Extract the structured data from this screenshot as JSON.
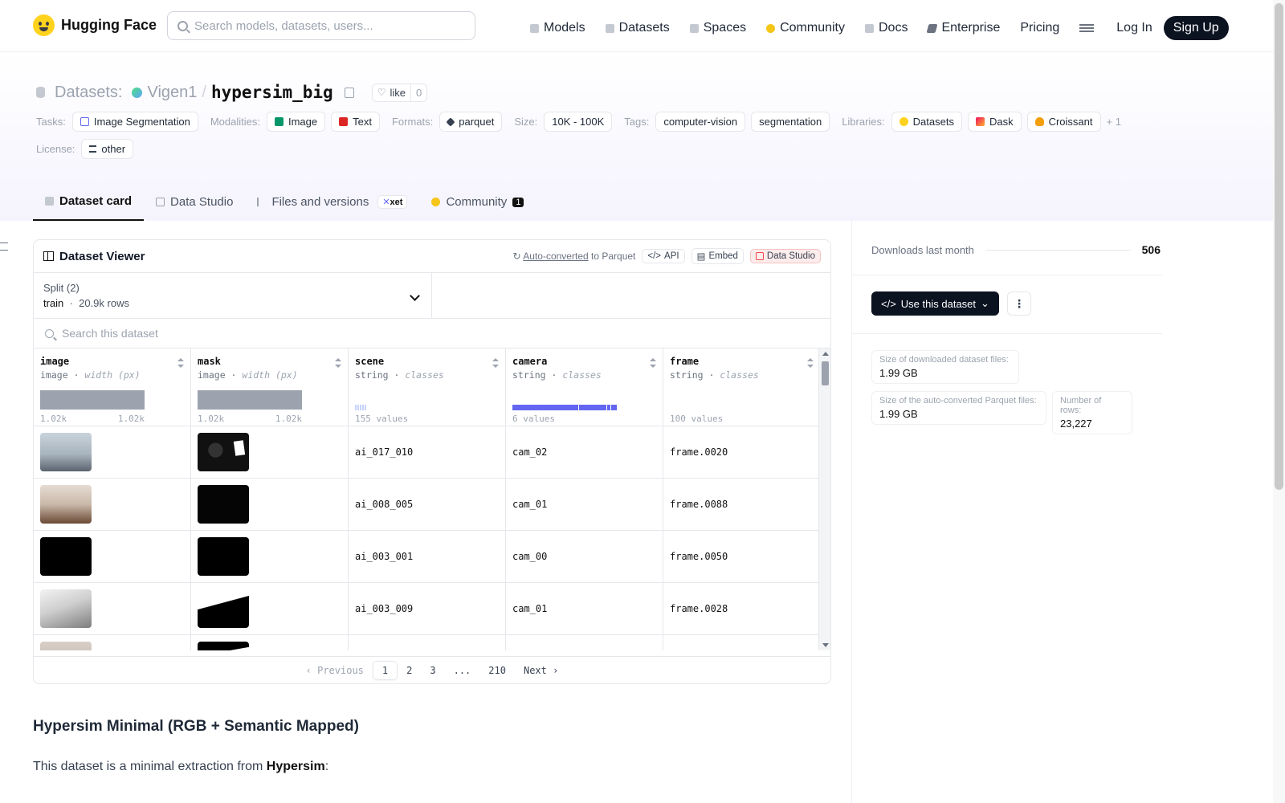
{
  "nav": {
    "brand": "Hugging Face",
    "search_placeholder": "Search models, datasets, users...",
    "links": [
      "Models",
      "Datasets",
      "Spaces",
      "Community",
      "Docs",
      "Enterprise",
      "Pricing"
    ],
    "login": "Log In",
    "signup": "Sign Up"
  },
  "header": {
    "crumb_label": "Datasets:",
    "owner": "Vigen1",
    "slash": "/",
    "name": "hypersim_big",
    "like_label": "like",
    "like_count": "0",
    "tags": {
      "tasks_label": "Tasks:",
      "tasks": [
        "Image Segmentation"
      ],
      "modalities_label": "Modalities:",
      "modalities": [
        "Image",
        "Text"
      ],
      "formats_label": "Formats:",
      "formats": [
        "parquet"
      ],
      "size_label": "Size:",
      "size": "10K - 100K",
      "tags_label": "Tags:",
      "tags": [
        "computer-vision",
        "segmentation"
      ],
      "libraries_label": "Libraries:",
      "libraries": [
        "Datasets",
        "Dask",
        "Croissant"
      ],
      "more": "+ 1",
      "license_label": "License:",
      "license": "other"
    },
    "tabs": [
      "Dataset card",
      "Data Studio",
      "Files and versions",
      "Community"
    ],
    "xet_badge": "xet",
    "community_count": "1"
  },
  "viewer": {
    "title": "Dataset Viewer",
    "autoconv_link": "Auto-converted",
    "autoconv_rest": "to Parquet",
    "api": "API",
    "embed": "Embed",
    "studio": "Data Studio",
    "split_label": "Split (2)",
    "split_value": "train",
    "split_dot": "·",
    "split_rows": "20.9k rows",
    "search_placeholder": "Search this dataset",
    "columns": [
      {
        "name": "image",
        "type": "image",
        "stat": "width (px)",
        "min": "1.02k",
        "max": "1.02k"
      },
      {
        "name": "mask",
        "type": "image",
        "stat": "width (px)",
        "min": "1.02k",
        "max": "1.02k"
      },
      {
        "name": "scene",
        "type": "string",
        "stat": "classes",
        "values": "155 values"
      },
      {
        "name": "camera",
        "type": "string",
        "stat": "classes",
        "values": "6 values"
      },
      {
        "name": "frame",
        "type": "string",
        "stat": "classes",
        "values": "100 values"
      }
    ],
    "rows": [
      {
        "scene": "ai_017_010",
        "camera": "cam_02",
        "frame": "frame.0020"
      },
      {
        "scene": "ai_008_005",
        "camera": "cam_01",
        "frame": "frame.0088"
      },
      {
        "scene": "ai_003_001",
        "camera": "cam_00",
        "frame": "frame.0050"
      },
      {
        "scene": "ai_003_009",
        "camera": "cam_01",
        "frame": "frame.0028"
      }
    ],
    "pager": {
      "prev": "Previous",
      "pages": [
        "1",
        "2",
        "3",
        "...",
        "210"
      ],
      "next": "Next"
    }
  },
  "readme": {
    "heading": "Hypersim Minimal (RGB + Semantic Mapped)",
    "intro_before": "This dataset is a minimal extraction from ",
    "intro_link": "Hypersim",
    "intro_after": ":"
  },
  "sidebar": {
    "downloads_label": "Downloads last month",
    "downloads_value": "506",
    "use_button": "Use this dataset",
    "stats": [
      {
        "label": "Size of downloaded dataset files:",
        "value": "1.99 GB"
      },
      {
        "label": "Size of the auto-converted Parquet files:",
        "value": "1.99 GB"
      },
      {
        "label": "Number of rows:",
        "value": "23,227"
      }
    ]
  },
  "colors": {
    "brand_yellow": "#ffd21e",
    "dark": "#0b1220",
    "accent_blue": "#6366f1"
  }
}
